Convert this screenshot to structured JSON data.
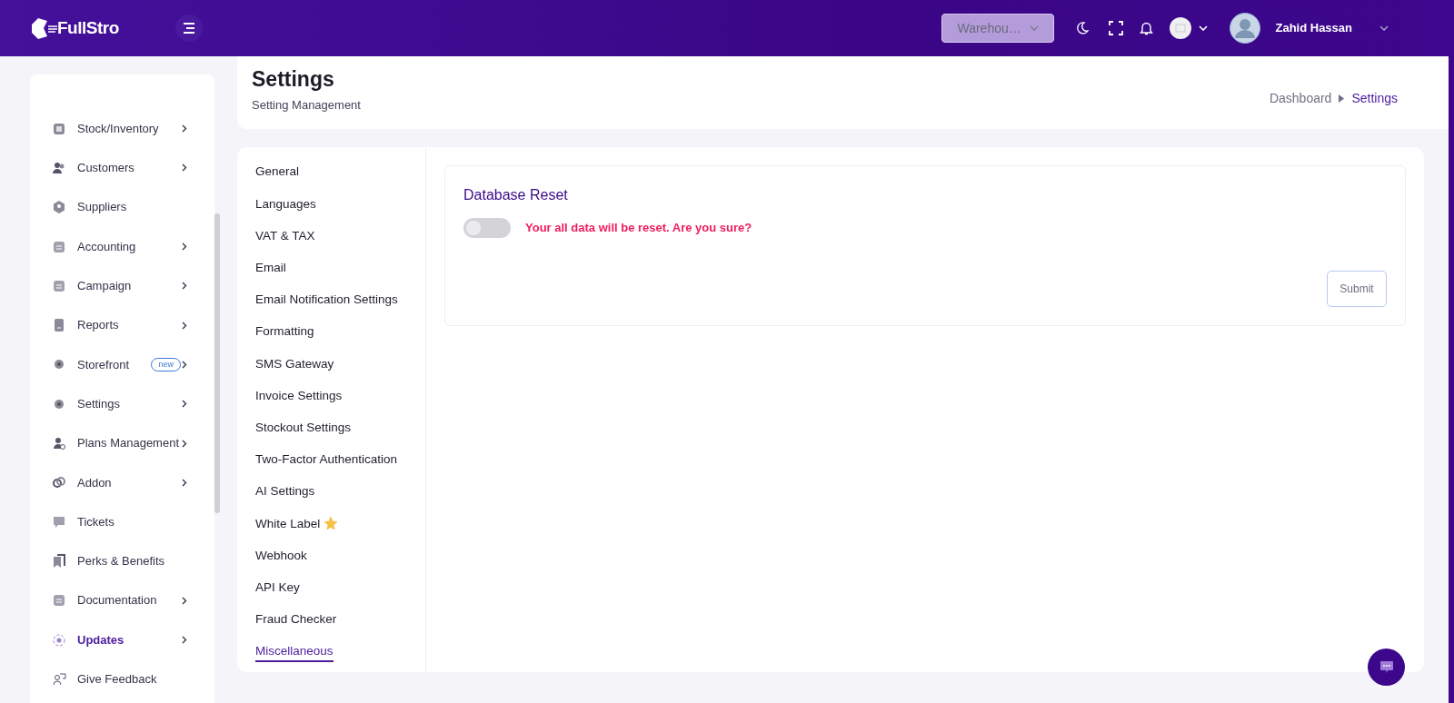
{
  "header": {
    "logo": "FullStro",
    "warehouse": {
      "value": "Warehou…"
    },
    "user": {
      "name": "Zahid Hassan"
    }
  },
  "sidebar": {
    "items": [
      {
        "label": "Stock/Inventory",
        "has_submenu": true,
        "selected": false
      },
      {
        "label": "Customers",
        "has_submenu": true,
        "selected": false
      },
      {
        "label": "Suppliers",
        "has_submenu": false,
        "selected": false
      },
      {
        "label": "Accounting",
        "has_submenu": true,
        "selected": false
      },
      {
        "label": "Campaign",
        "has_submenu": true,
        "selected": false
      },
      {
        "label": "Reports",
        "has_submenu": true,
        "selected": false
      },
      {
        "label": "Storefront",
        "has_submenu": true,
        "badge": "new",
        "selected": false
      },
      {
        "label": "Settings",
        "has_submenu": true,
        "selected": false
      },
      {
        "label": "Plans Management",
        "has_submenu": true,
        "selected": false
      },
      {
        "label": "Addon",
        "has_submenu": true,
        "selected": false
      },
      {
        "label": "Tickets",
        "has_submenu": false,
        "selected": false
      },
      {
        "label": "Perks & Benefits",
        "has_submenu": false,
        "selected": false
      },
      {
        "label": "Documentation",
        "has_submenu": true,
        "selected": false
      },
      {
        "label": "Updates",
        "has_submenu": true,
        "selected": true
      },
      {
        "label": "Give Feedback",
        "has_submenu": false,
        "selected": false
      }
    ]
  },
  "page_header": {
    "title": "Settings",
    "subtitle": "Setting Management",
    "breadcrumb": [
      {
        "label": "Dashboard",
        "current": false
      },
      {
        "label": "Settings",
        "current": true
      }
    ]
  },
  "settings_menu": [
    {
      "label": "General",
      "selected": false
    },
    {
      "label": "Languages",
      "selected": false
    },
    {
      "label": "VAT & TAX",
      "selected": false
    },
    {
      "label": "Email",
      "selected": false
    },
    {
      "label": "Email Notification Settings",
      "selected": false
    },
    {
      "label": "Formatting",
      "selected": false
    },
    {
      "label": "SMS Gateway",
      "selected": false
    },
    {
      "label": "Invoice Settings",
      "selected": false
    },
    {
      "label": "Stockout Settings",
      "selected": false
    },
    {
      "label": "Two-Factor Authentication",
      "selected": false
    },
    {
      "label": "AI Settings",
      "selected": false
    },
    {
      "label": "White Label",
      "selected": false,
      "star": true
    },
    {
      "label": "Webhook",
      "selected": false
    },
    {
      "label": "API Key",
      "selected": false
    },
    {
      "label": "Fraud Checker",
      "selected": false
    },
    {
      "label": "Miscellaneous",
      "selected": true
    }
  ],
  "panel": {
    "title": "Database Reset",
    "toggle": {
      "on": false,
      "label": "Your all data will be reset. Are you sure?"
    },
    "submit": "Submit"
  }
}
